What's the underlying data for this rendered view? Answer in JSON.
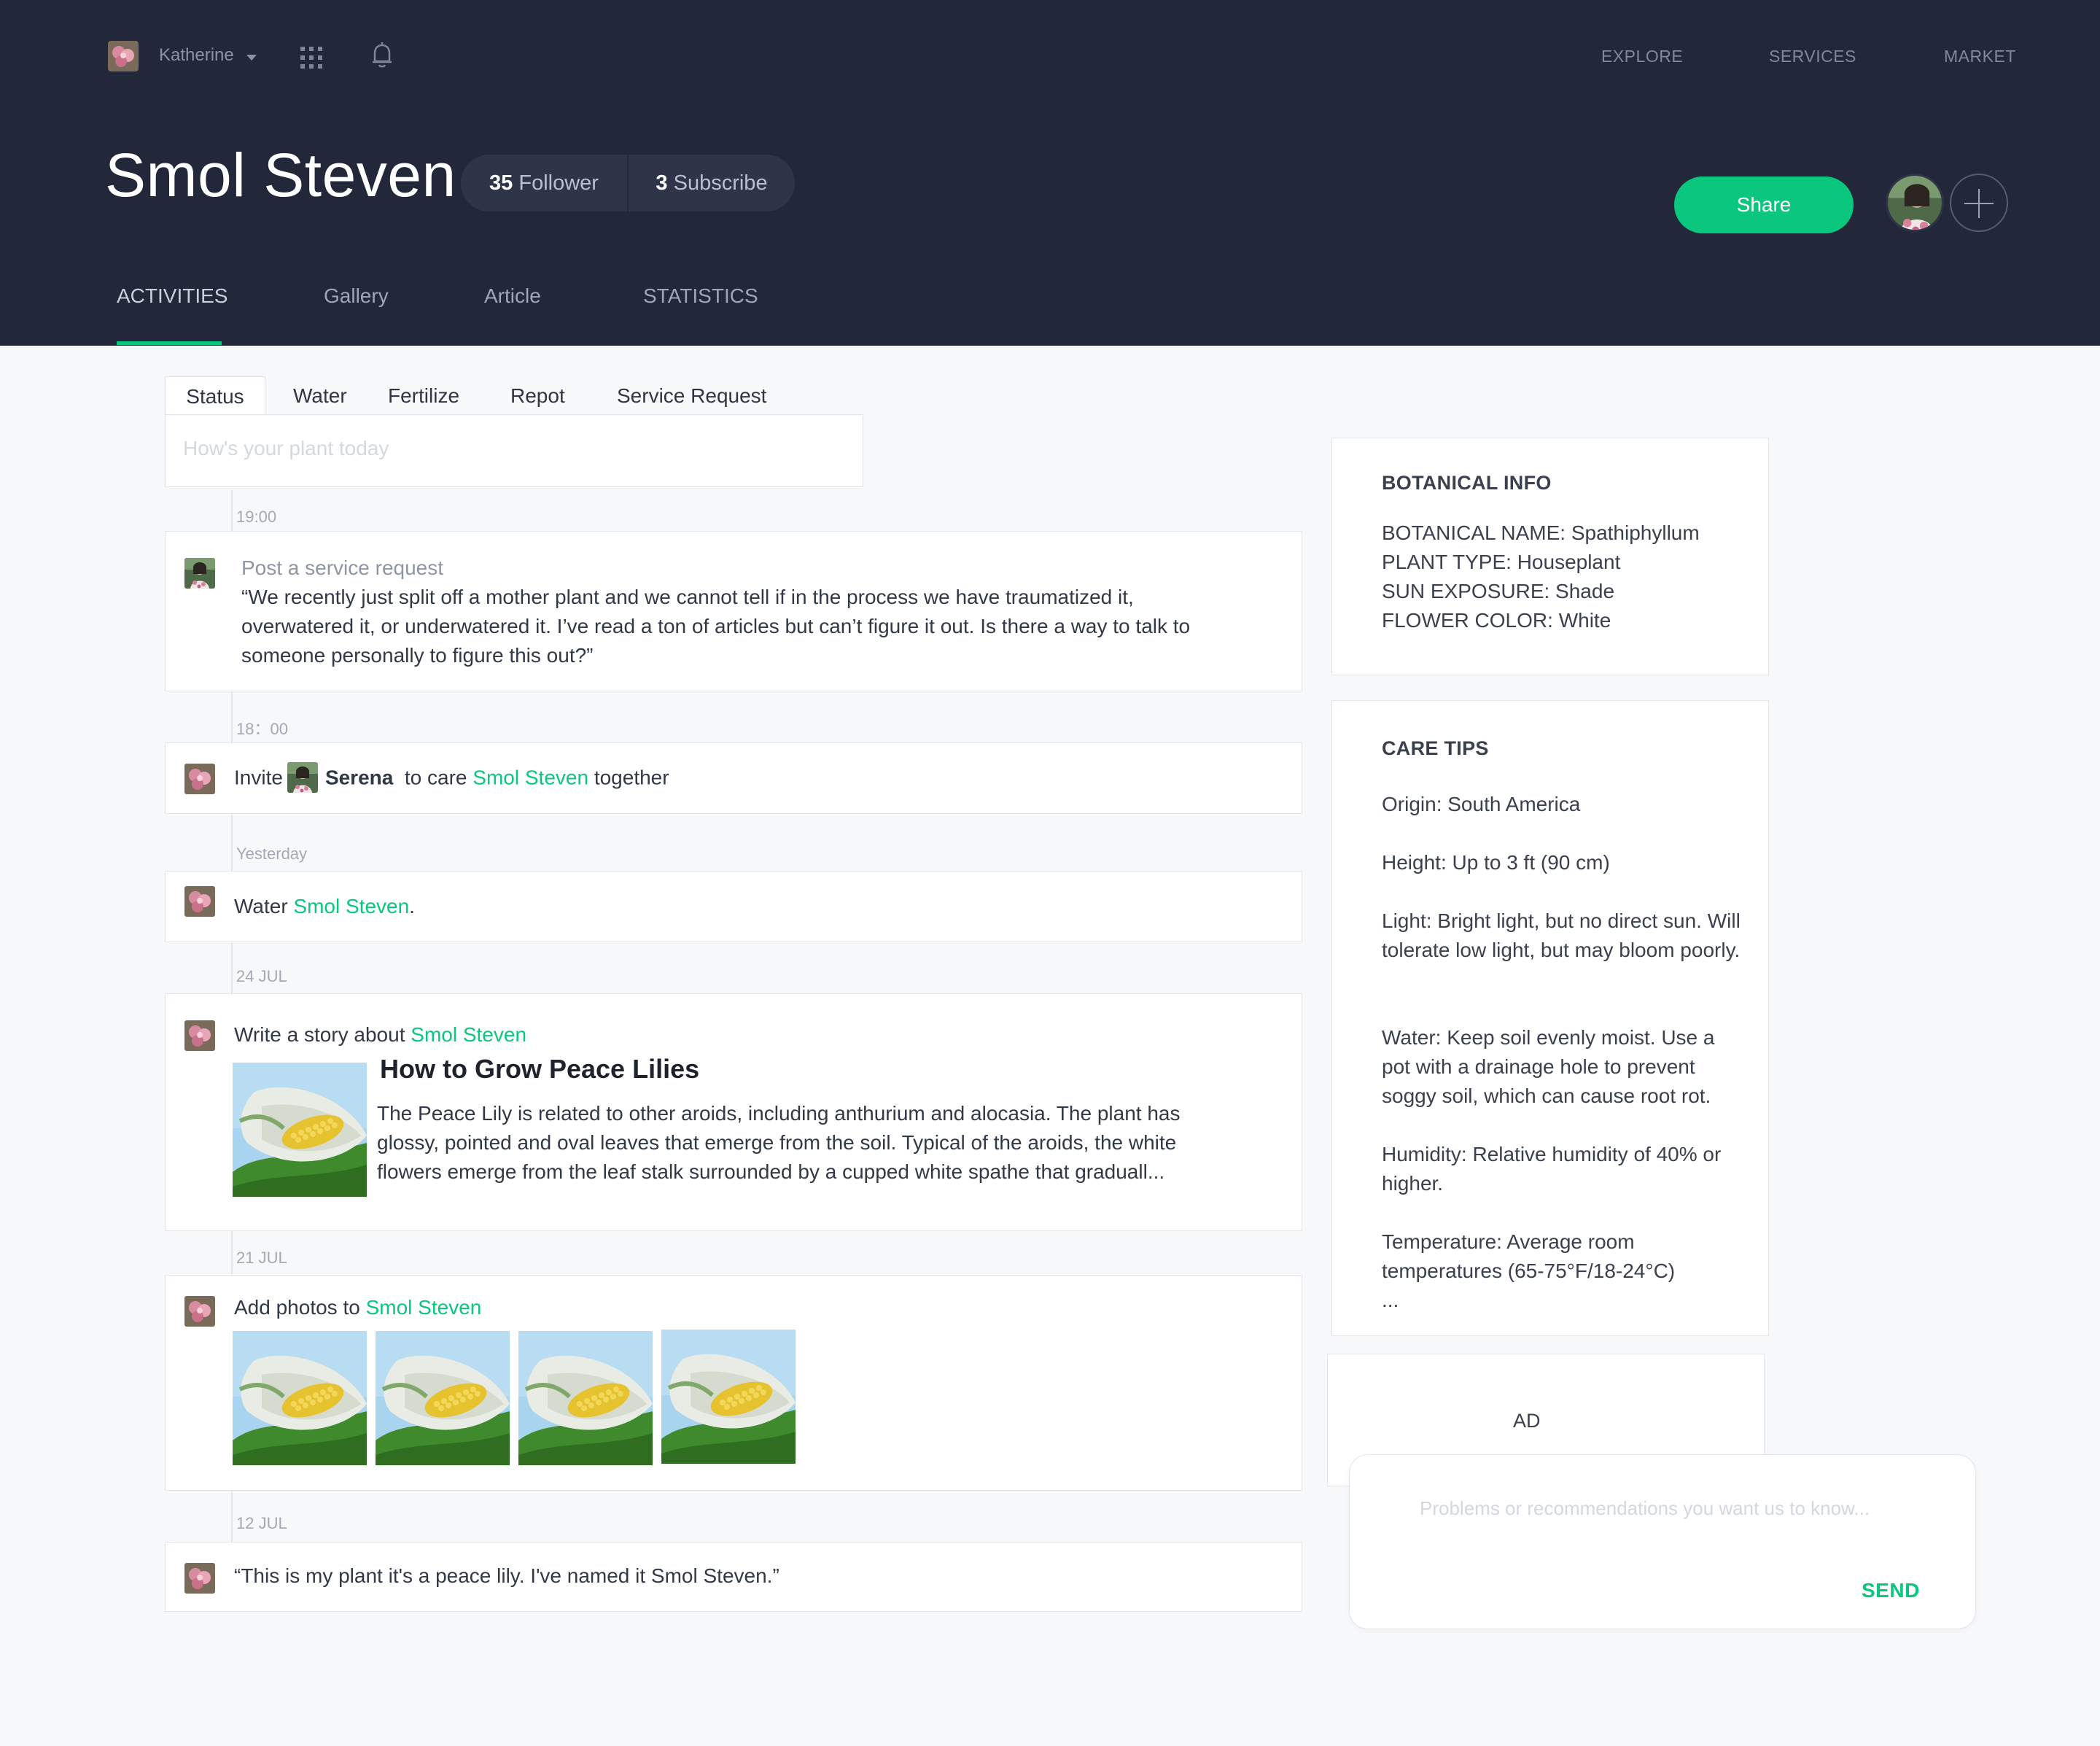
{
  "topbar": {
    "username": "Katherine",
    "nav": [
      "EXPLORE",
      "SERVICES",
      "MARKET"
    ]
  },
  "profile": {
    "title": "Smol Steven",
    "follower_count": "35",
    "follower_label": "Follower",
    "subscribe_count": "3",
    "subscribe_label": "Subscribe",
    "share_label": "Share"
  },
  "main_tabs": [
    "ACTIVITIES",
    "Gallery",
    "Article",
    "STATISTICS"
  ],
  "composer": {
    "tabs": [
      "Status",
      "Water",
      "Fertilize",
      "Repot",
      "Service Request"
    ],
    "placeholder": "How's your plant today"
  },
  "timeline": [
    {
      "time": "19:00",
      "action": "Post a service request",
      "text": "“We recently just split off a mother plant and we cannot tell if in the process we have traumatized it, overwatered it, or underwatered it. I’ve read a ton of articles but can’t figure it out. Is there a way to talk to someone personally to figure this out?”"
    },
    {
      "time": "18：00",
      "prefix": "Invite",
      "person": "Serena",
      "middle": "to care",
      "plant": "Smol Steven",
      "suffix": "together"
    },
    {
      "time": "Yesterday",
      "prefix": "Water",
      "plant": "Smol Steven",
      "suffix": "."
    },
    {
      "time": "24 JUL",
      "prefix": "Write a story about",
      "plant": "Smol Steven",
      "article_title": "How to Grow Peace Lilies",
      "article_body": "The Peace Lily is related to other aroids, including anthurium and alocasia. The plant has glossy, pointed and oval leaves that emerge from the soil. Typical of the aroids, the white flowers emerge from the leaf stalk surrounded by a cupped white spathe that graduall..."
    },
    {
      "time": "21 JUL",
      "prefix": "Add photos to",
      "plant": "Smol Steven",
      "photo_count": 4
    },
    {
      "time": "12 JUL",
      "text": "“This is my plant it's a peace lily. I've named it Smol Steven.”"
    }
  ],
  "botanical": {
    "title": "BOTANICAL INFO",
    "lines": [
      "BOTANICAL NAME: Spathiphyllum",
      "PLANT TYPE:  Houseplant",
      "SUN EXPOSURE:  Shade",
      "FLOWER COLOR:  White"
    ]
  },
  "care": {
    "title": "CARE TIPS",
    "tips": [
      "Origin: South America",
      "Height: Up to 3 ft (90 cm)",
      "Light: Bright light, but no direct sun. Will tolerate low light, but may bloom poorly.",
      "Water: Keep soil evenly moist. Use a pot with a drainage hole to prevent soggy soil, which can cause root rot.",
      "Humidity: Relative humidity of 40% or higher.",
      "Temperature: Average room temperatures (65-75°F/18-24°C)"
    ],
    "more": "..."
  },
  "ad": {
    "label": "AD"
  },
  "feedback": {
    "placeholder": "Problems or recommendations you want us to know...",
    "send_label": "SEND"
  },
  "colors": {
    "header_bg": "#222839",
    "accent": "#0ac77d",
    "page_bg": "#f7f8fa"
  },
  "icons": [
    "avatar",
    "chevron-down-icon",
    "apps-grid-icon",
    "bell-icon",
    "plus-icon"
  ]
}
